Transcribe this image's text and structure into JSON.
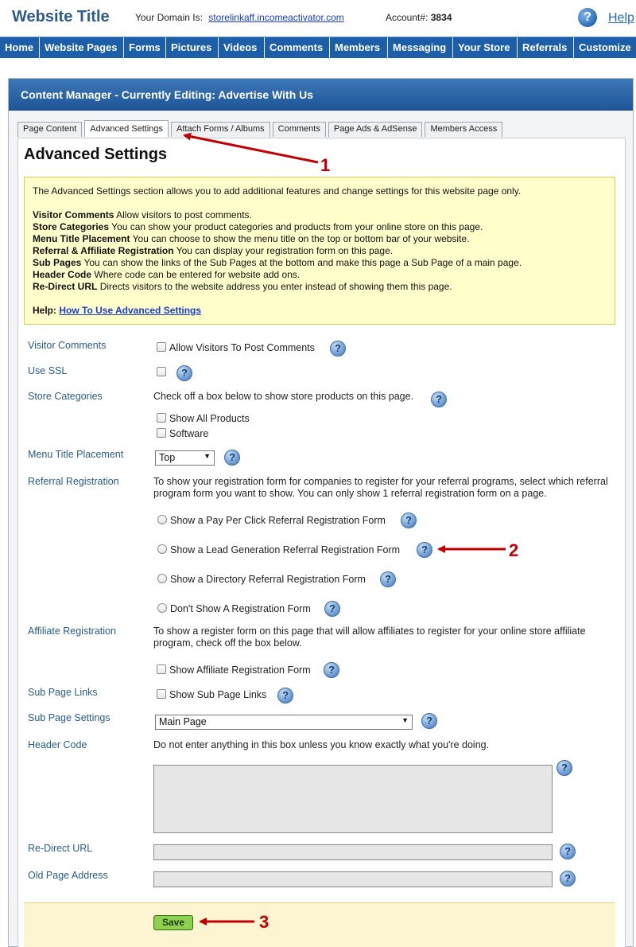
{
  "header": {
    "site_title": "Website Title",
    "domain_label": "Your Domain Is:",
    "domain_value": "storelinkaff.incomeactivator.com",
    "account_label": "Account#:",
    "account_value": "3834",
    "help_label": "Help"
  },
  "nav": [
    "Home",
    "Website Pages",
    "Forms",
    "Pictures",
    "Videos",
    "Comments",
    "Members",
    "Messaging",
    "Your Store",
    "Referrals",
    "Customize"
  ],
  "panel": {
    "title": "Content Manager - Currently Editing: Advertise With Us",
    "tabs": [
      "Page Content",
      "Advanced Settings",
      "Attach Forms / Albums",
      "Comments",
      "Page Ads & AdSense",
      "Members Access"
    ],
    "active_tab": "Advanced Settings"
  },
  "page_heading": "Advanced Settings",
  "info": {
    "intro": "The Advanced Settings section allows you to add additional features and change settings for this website page only.",
    "items": [
      {
        "term": "Visitor Comments",
        "desc": "Allow visitors to post comments."
      },
      {
        "term": "Store Categories",
        "desc": "You can show your product categories and products from your online store on this page."
      },
      {
        "term": "Menu Title Placement",
        "desc": "You can choose to show the menu title on the top or bottom bar of your website."
      },
      {
        "term": "Referral & Affiliate Registration",
        "desc": "You can display your registration form on this page."
      },
      {
        "term": "Sub Pages",
        "desc": "You can show the links of the Sub Pages at the bottom and make this page a Sub Page of a main page."
      },
      {
        "term": "Header Code",
        "desc": "Where code can be entered for website add ons."
      },
      {
        "term": "Re-Direct URL",
        "desc": "Directs visitors to the website address you enter instead of showing them this page."
      }
    ],
    "help_label": "Help:",
    "help_link": "How To Use Advanced Settings"
  },
  "form": {
    "visitor_comments": {
      "label": "Visitor Comments",
      "option": "Allow Visitors To Post Comments"
    },
    "use_ssl": {
      "label": "Use SSL"
    },
    "store_categories": {
      "label": "Store Categories",
      "intro": "Check off a box below to show store products on this page.",
      "options": [
        "Show All Products",
        "Software"
      ]
    },
    "menu_title_placement": {
      "label": "Menu Title Placement",
      "value": "Top"
    },
    "referral_registration": {
      "label": "Referral Registration",
      "intro": "To show your registration form for companies to register for your referral programs, select which referral program form you want to show. You can only show 1 referral registration form on a page.",
      "options": [
        "Show a Pay Per Click Referral Registration Form",
        "Show a Lead Generation Referral Registration Form",
        "Show a Directory Referral Registration Form",
        "Don't Show A Registration Form"
      ]
    },
    "affiliate_registration": {
      "label": "Affiliate Registration",
      "intro": "To show a register form on this page that will allow affiliates to register for your online store affiliate program, check off the box below.",
      "option": "Show Affiliate Registration Form"
    },
    "sub_page_links": {
      "label": "Sub Page Links",
      "option": "Show Sub Page Links"
    },
    "sub_page_settings": {
      "label": "Sub Page Settings",
      "value": "Main Page"
    },
    "header_code": {
      "label": "Header Code",
      "intro": "Do not enter anything in this box unless you know exactly what you're doing."
    },
    "redirect_url": {
      "label": "Re-Direct URL"
    },
    "old_page_address": {
      "label": "Old Page Address"
    }
  },
  "save_label": "Save",
  "annotations": [
    "1",
    "2",
    "3"
  ],
  "colors": {
    "nav_bg": "#1c5ea8",
    "annotation": "#c00000",
    "info_bg": "#ffffcc",
    "save_bg": "#8fd14f"
  }
}
